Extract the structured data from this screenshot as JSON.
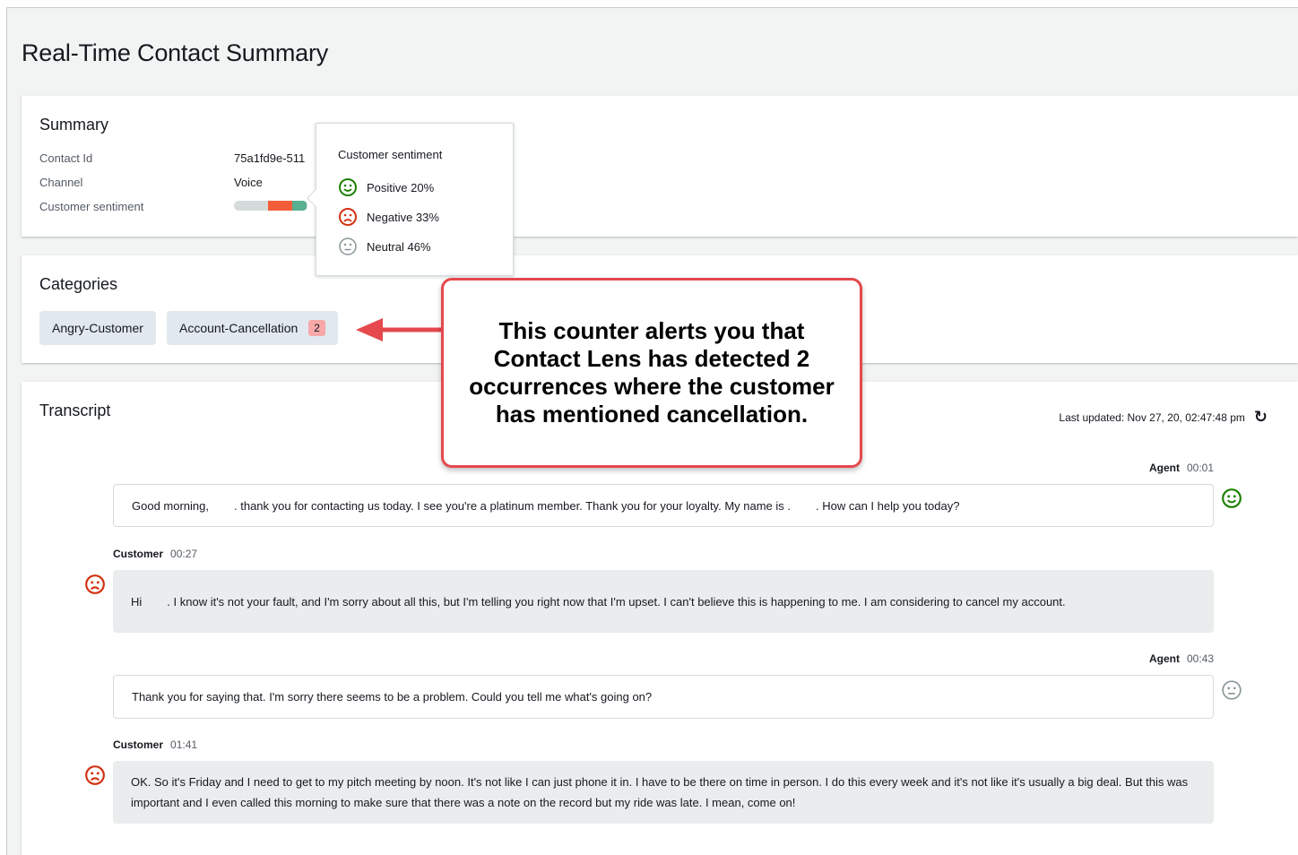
{
  "page": {
    "title": "Real-Time Contact Summary"
  },
  "summary": {
    "heading": "Summary",
    "contact_id_label": "Contact Id",
    "contact_id_value": "75a1fd9e-511",
    "channel_label": "Channel",
    "channel_value": "Voice",
    "sentiment_label": "Customer sentiment",
    "sentiment_bar": {
      "neutral": 0.46,
      "negative": 0.33,
      "positive": 0.2
    }
  },
  "popover": {
    "title": "Customer sentiment",
    "rows": [
      {
        "label": "Positive 20%",
        "icon": "smile-icon",
        "color": "#1d8102"
      },
      {
        "label": "Negative 33%",
        "icon": "frown-icon",
        "color": "#d13212"
      },
      {
        "label": "Neutral 46%",
        "icon": "neutral-face-icon",
        "color": "#879596"
      }
    ]
  },
  "categories": {
    "heading": "Categories",
    "chips": [
      {
        "label": "Angry-Customer"
      },
      {
        "label": "Account-Cancellation",
        "count": "2"
      }
    ]
  },
  "callout": {
    "text": "This counter alerts you that Contact Lens has detected 2 occurrences where the customer has mentioned cancellation."
  },
  "transcript": {
    "heading": "Transcript",
    "last_updated": "Last updated: Nov 27, 20, 02:47:48 pm",
    "messages": [
      {
        "speaker": "Agent",
        "time": "00:01",
        "text_a": "Good morning,",
        "text_b": ". thank you for contacting us today. I see you're a platinum member. Thank you for your loyalty. My name is .",
        "text_c": ". How can I help you today?",
        "sentiment": "positive"
      },
      {
        "speaker": "Customer",
        "time": "00:27",
        "text_a": "Hi",
        "text_b": ". I know it's not your fault, and I'm sorry about all this, but I'm telling you right now that I'm upset. I can't believe this is happening to me. I am considering to cancel my account.",
        "sentiment": "negative"
      },
      {
        "speaker": "Agent",
        "time": "00:43",
        "text": "Thank you for saying that. I'm sorry there seems to be a problem. Could you tell me what's going on?",
        "sentiment": "neutral"
      },
      {
        "speaker": "Customer",
        "time": "01:41",
        "text": "OK. So it's Friday and I need to get to my pitch meeting by noon. It's not like I can just phone it in. I have to be there on time in person. I do this every week and it's not like it's usually a big deal. But this was important and I even called this morning to make sure that there was a note on the record but my ride was late. I mean, come on!",
        "sentiment": "negative"
      }
    ]
  },
  "colors": {
    "positive": "#1d8102",
    "negative": "#d13212",
    "neutral": "#879596",
    "callout_border": "#e5484d",
    "arrow": "#e5484d"
  }
}
